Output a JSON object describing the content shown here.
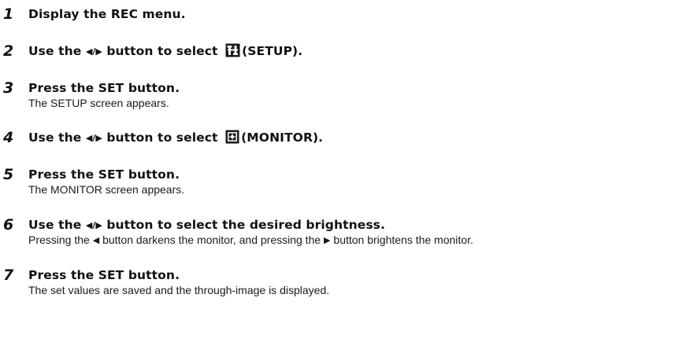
{
  "steps": [
    {
      "number": "1",
      "title": "Display the REC menu."
    },
    {
      "number": "2",
      "title_before": "Use the",
      "arrows": "◀/▶",
      "title_mid": "button to select",
      "icon": "setup-wrench-icon",
      "title_after": "(SETUP)."
    },
    {
      "number": "3",
      "title": "Press the SET button.",
      "description": "The SETUP screen appears."
    },
    {
      "number": "4",
      "title_before": "Use the",
      "arrows": "◀/▶",
      "title_mid": "button to select",
      "icon": "monitor-brightness-icon",
      "title_after": "(MONITOR)."
    },
    {
      "number": "5",
      "title": "Press the SET button.",
      "description": "The MONITOR screen appears."
    },
    {
      "number": "6",
      "title_before": "Use the",
      "arrows": "◀/▶",
      "title_after": "button to select the desired brightness.",
      "desc_part1": "Pressing the",
      "left_arrow": "◀",
      "desc_part2": "button darkens the monitor, and pressing the",
      "right_arrow": "▶",
      "desc_part3": "button brightens the monitor."
    },
    {
      "number": "7",
      "title": "Press the SET button.",
      "description": "The set values are saved and the through-image is displayed."
    }
  ]
}
